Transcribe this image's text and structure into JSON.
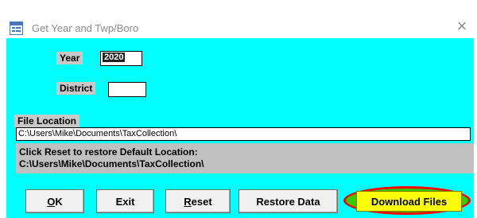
{
  "window": {
    "title": "Get Year and Twp/Boro",
    "close_glyph": "×",
    "icon": "form-icon"
  },
  "form": {
    "year_label": "Year",
    "year_value": "2020",
    "district_label": "District",
    "district_value": "",
    "file_location_label": "File Location",
    "file_location_value": "C:\\Users\\Mike\\Documents\\TaxCollection\\",
    "info_line1": "Click Reset to restore Default Location:",
    "info_line2": "C:\\Users\\Mike\\Documents\\TaxCollection\\"
  },
  "buttons": {
    "ok_access_key": "O",
    "ok_rest": "K",
    "exit_label": "Exit",
    "reset_access_key": "R",
    "reset_rest": "eset",
    "restore_label": "Restore Data",
    "download_label": "Download Files"
  },
  "colors": {
    "form_background": "#00ffff",
    "download_button": "#ffff00",
    "highlight_ring": "#ff0000",
    "highlight_fill": "#33cc00"
  }
}
